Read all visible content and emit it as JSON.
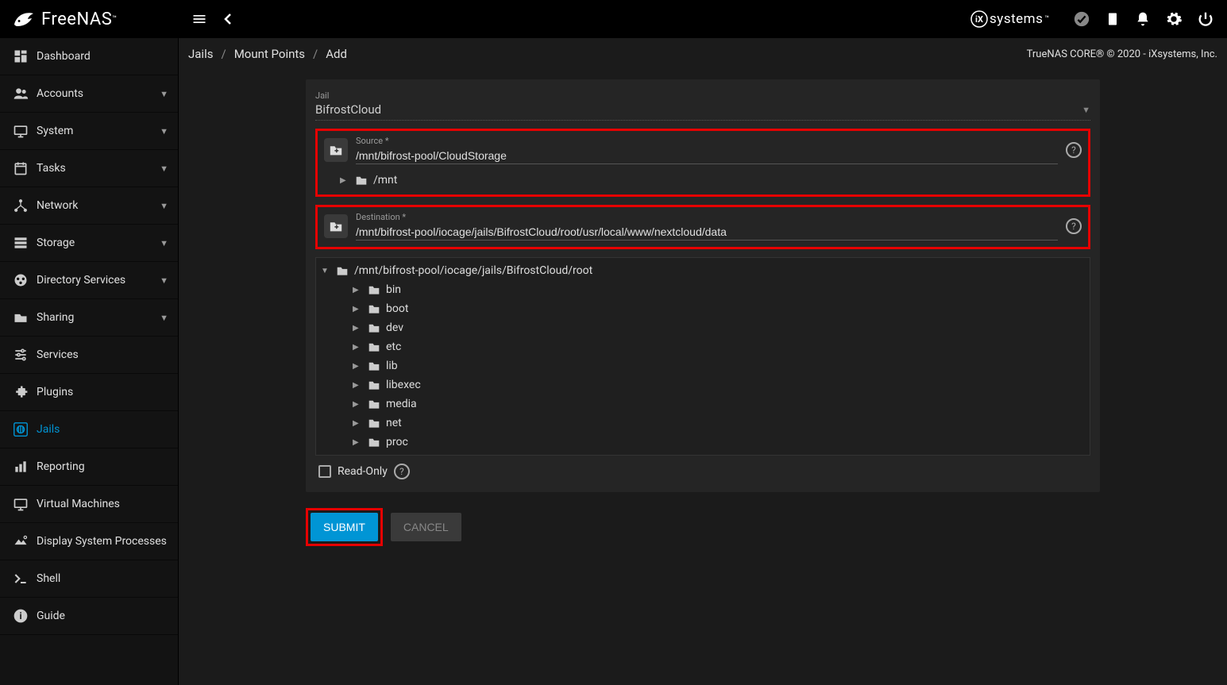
{
  "brand": "FreeNAS",
  "ix_brand": "systems",
  "copyright": "TrueNAS CORE® © 2020 - iXsystems, Inc.",
  "breadcrumb": {
    "jails": "Jails",
    "mount_points": "Mount Points",
    "add": "Add"
  },
  "sidebar": {
    "dashboard": "Dashboard",
    "accounts": "Accounts",
    "system": "System",
    "tasks": "Tasks",
    "network": "Network",
    "storage": "Storage",
    "directory_services": "Directory Services",
    "sharing": "Sharing",
    "services": "Services",
    "plugins": "Plugins",
    "jails": "Jails",
    "reporting": "Reporting",
    "virtual_machines": "Virtual Machines",
    "display_system_processes": "Display System Processes",
    "shell": "Shell",
    "guide": "Guide"
  },
  "form": {
    "jail_label": "Jail",
    "jail_value": "BifrostCloud",
    "source_label": "Source *",
    "source_value": "/mnt/bifrost-pool/CloudStorage",
    "source_tree_mnt": "/mnt",
    "dest_label": "Destination *",
    "dest_value": "/mnt/bifrost-pool/iocage/jails/BifrostCloud/root/usr/local/www/nextcloud/data",
    "dest_root": "/mnt/bifrost-pool/iocage/jails/BifrostCloud/root",
    "tree": {
      "bin": "bin",
      "boot": "boot",
      "dev": "dev",
      "etc": "etc",
      "lib": "lib",
      "libexec": "libexec",
      "media": "media",
      "net": "net",
      "proc": "proc"
    },
    "readonly_label": "Read-Only"
  },
  "buttons": {
    "submit": "Submit",
    "cancel": "Cancel"
  }
}
